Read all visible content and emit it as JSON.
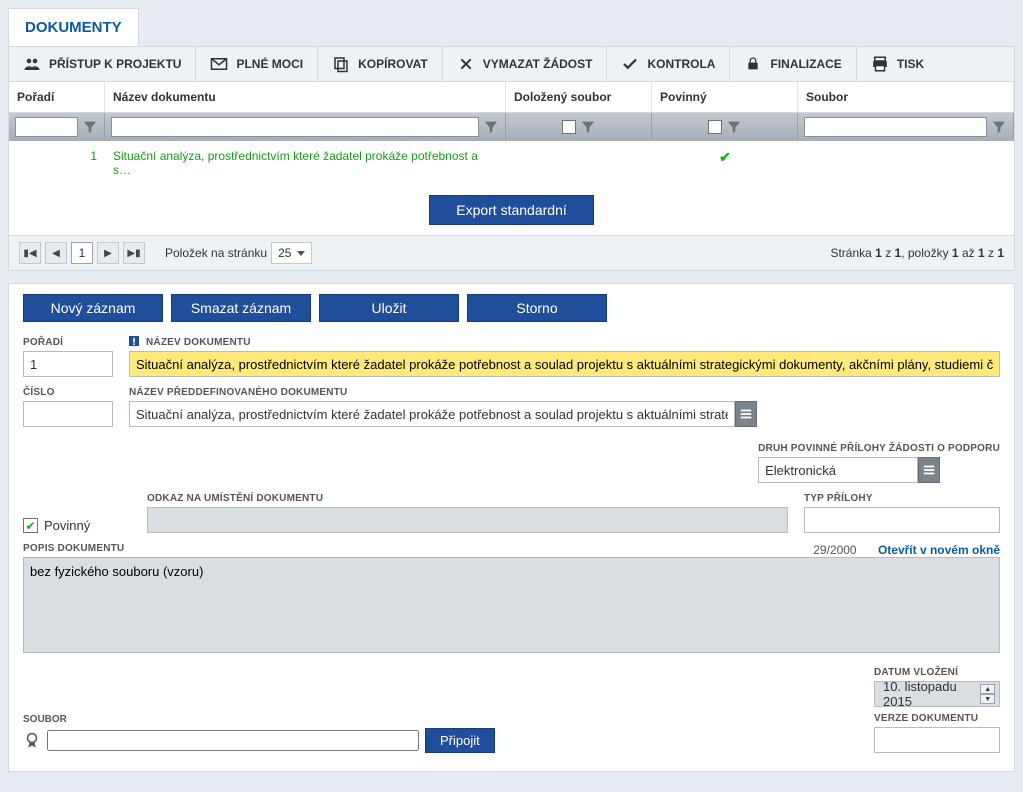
{
  "tab_title": "DOKUMENTY",
  "toolbar": {
    "access": "PŘÍSTUP K PROJEKTU",
    "poa": "PLNÉ MOCI",
    "copy": "KOPÍROVAT",
    "delete": "VYMAZAT ŽÁDOST",
    "check": "KONTROLA",
    "finalize": "FINALIZACE",
    "print": "TISK"
  },
  "grid": {
    "headers": {
      "order": "Pořadí",
      "name": "Název dokumentu",
      "file": "Doložený soubor",
      "required": "Povinný",
      "soubor": "Soubor"
    },
    "row": {
      "order": "1",
      "name": "Situační analýza, prostřednictvím které žadatel prokáže potřebnost a s…",
      "required_check": true
    },
    "export_label": "Export standardní"
  },
  "pager": {
    "per_page_label": "Položek na stránku",
    "per_page_value": "25",
    "current_page": "1",
    "status_prefix": "Stránka ",
    "status_page_a": "1",
    "status_z1": " z ",
    "status_page_b": "1",
    "status_items": ", položky ",
    "status_from": "1",
    "status_az": " až ",
    "status_to": "1",
    "status_z2": " z ",
    "status_total": "1"
  },
  "actions": {
    "new": "Nový záznam",
    "delete": "Smazat záznam",
    "save": "Uložit",
    "cancel": "Storno"
  },
  "form": {
    "order_label": "POŘADÍ",
    "order_value": "1",
    "docname_label": "NÁZEV DOKUMENTU",
    "docname_value": "Situační analýza, prostřednictvím které žadatel prokáže potřebnost a soulad projektu s aktuálními strategickými dokumenty, akčními plány, studiemi či",
    "cislo_label": "ČÍSLO",
    "cislo_value": "",
    "predef_label": "NÁZEV PŘEDDEFINOVANÉHO DOKUMENTU",
    "predef_value": "Situační analýza, prostřednictvím které žadatel prokáže potřebnost a soulad projektu s aktuálními strategickými …",
    "druh_label": "DRUH POVINNÉ PŘÍLOHY ŽÁDOSTI O PODPORU",
    "druh_value": "Elektronická",
    "odkaz_label": "ODKAZ NA UMÍSTĚNÍ DOKUMENTU",
    "odkaz_value": "",
    "typ_label": "TYP PŘÍLOHY",
    "typ_value": "",
    "povinny_label": "Povinný",
    "popis_label": "POPIS DOKUMENTU",
    "popis_value": "bez fyzického souboru (vzoru)",
    "counter": "29/2000",
    "open_link": "Otevřít v novém okně",
    "soubor_label": "SOUBOR",
    "attach_label": "Připojit",
    "date_label": "DATUM VLOŽENÍ",
    "date_value": "10. listopadu 2015",
    "version_label": "VERZE DOKUMENTU",
    "version_value": ""
  }
}
